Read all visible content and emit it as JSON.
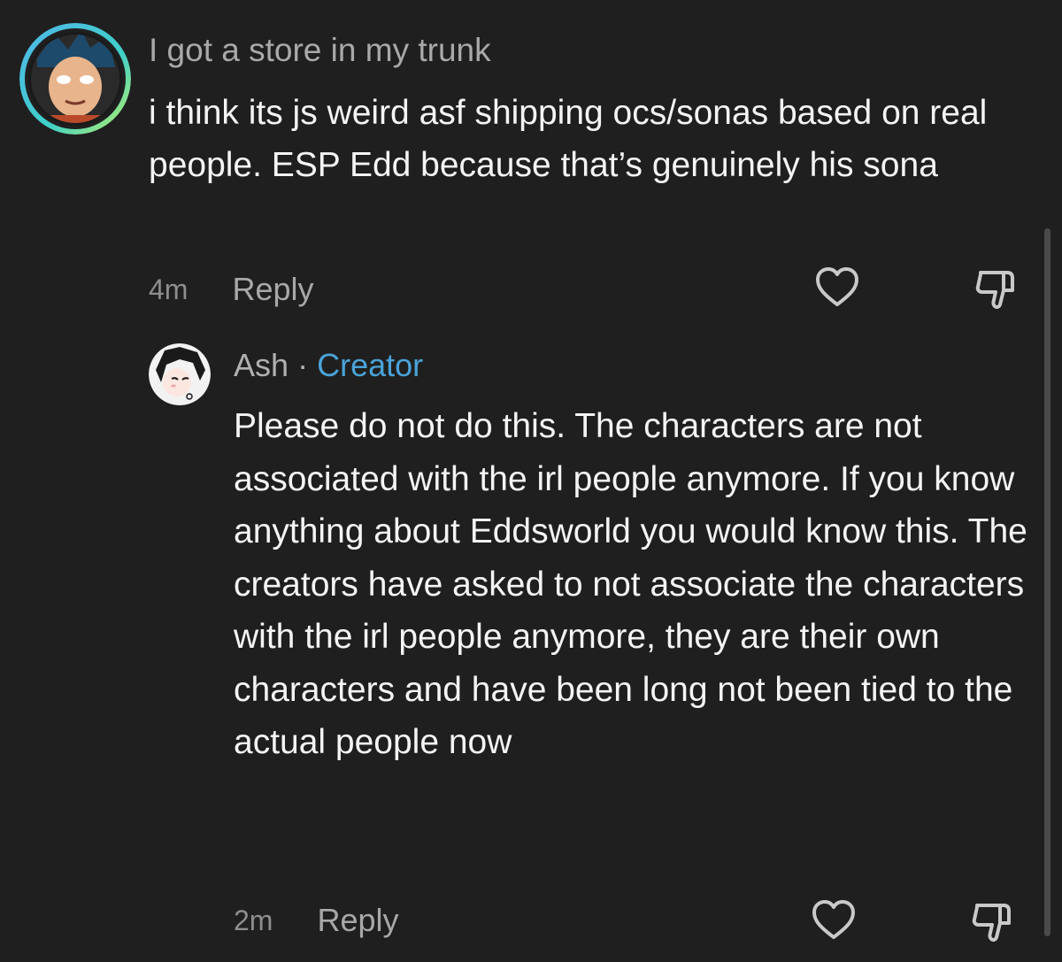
{
  "comment": {
    "username": "I got a store in my trunk",
    "text": "i think its js weird asf shipping ocs/sonas based on real people. ESP Edd because that’s genuinely his sona",
    "timestamp": "4m",
    "reply_label": "Reply"
  },
  "reply": {
    "username": "Ash",
    "separator": "·",
    "badge": "Creator",
    "text": "Please do not do this. The characters are not associated with the irl people anymore. If you know anything about Eddsworld you would know this. The creators have asked to not associate the characters with the irl people anymore, they are their own characters and have been long not been tied to the actual people now",
    "timestamp": "2m",
    "reply_label": "Reply"
  },
  "icons": {
    "like": "heart-icon",
    "dislike": "thumbs-down-icon"
  },
  "colors": {
    "background": "#1f1f1f",
    "creator_badge": "#4aa3d8",
    "muted_text": "#a9a9a9"
  }
}
